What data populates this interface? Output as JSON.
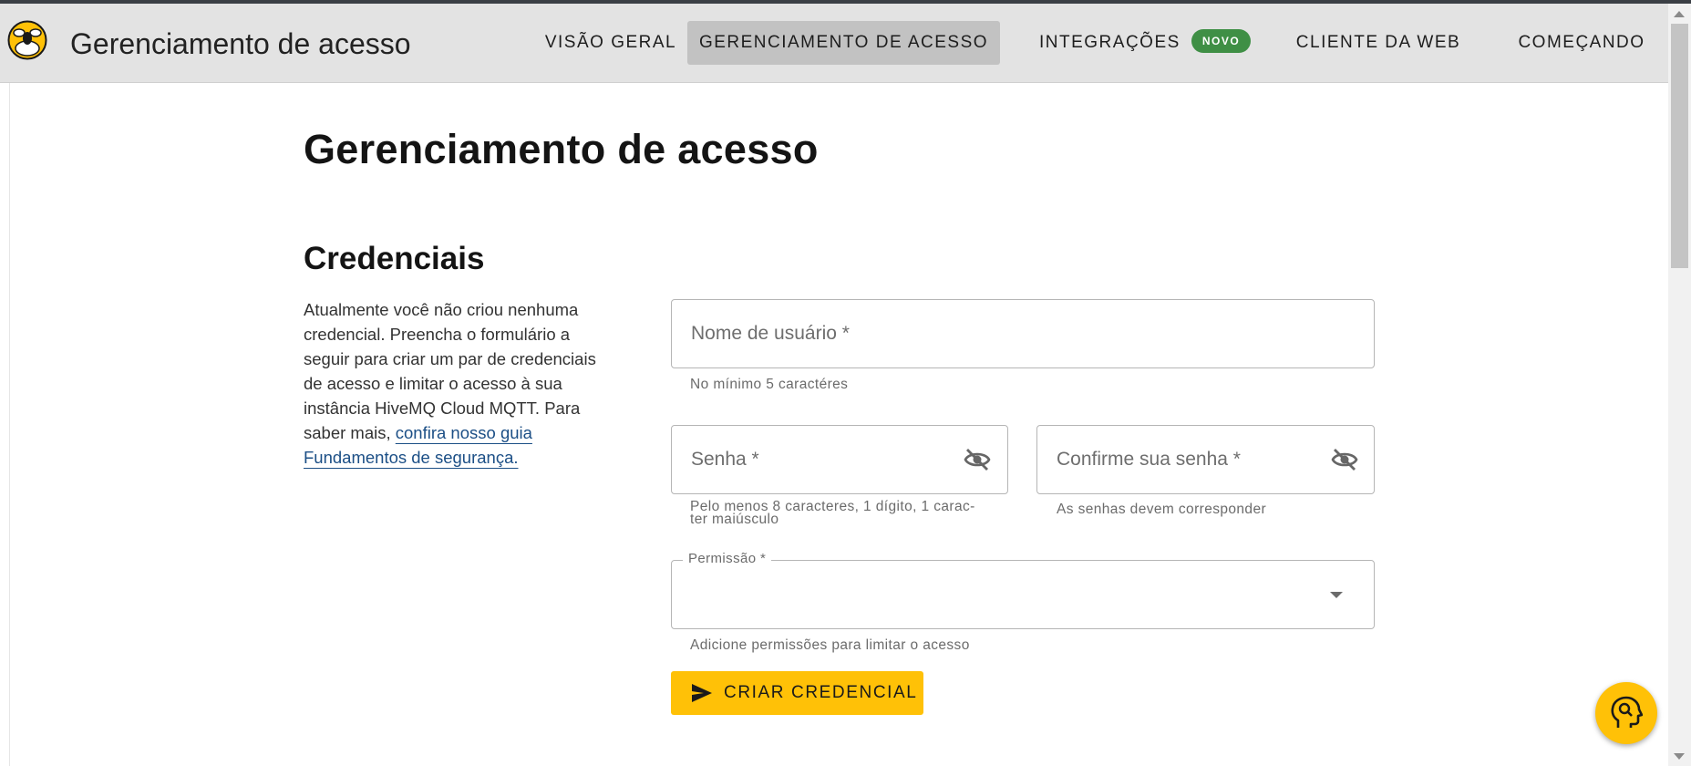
{
  "header": {
    "app_title": "Gerenciamento de acesso",
    "nav": [
      {
        "label": "VISÃO GERAL"
      },
      {
        "label": "GERENCIAMENTO DE ACESSO",
        "active": true
      },
      {
        "label": "INTEGRAÇÕES",
        "badge": "NOVO"
      },
      {
        "label": "CLIENTE DA WEB"
      },
      {
        "label": "COMEÇANDO"
      }
    ]
  },
  "main": {
    "page_title": "Gerenciamento de acesso",
    "section_title": "Credenciais",
    "intro_text": "Atualmente você não criou nenhuma credencial. Preencha o formulário a seguir para criar um par de credenciais de acesso e limitar o acesso à sua instância HiveMQ Cloud MQTT. Para saber mais, ",
    "intro_link": "confira nosso guia Fundamentos de segurança."
  },
  "form": {
    "username": {
      "placeholder": "Nome de usuário *",
      "helper": "No mínimo 5 caractéres"
    },
    "password": {
      "placeholder": "Senha *",
      "helper_line1": "Pelo menos 8 caracteres, 1 dígito, 1 carac-",
      "helper_line2": "ter maiúsculo"
    },
    "confirm": {
      "placeholder": "Confirme sua senha *",
      "helper": "As senhas devem corresponder"
    },
    "permission": {
      "label": "Permissão *",
      "value": "",
      "helper": "Adicione permissões para limitar o acesso"
    },
    "submit_label": "CRIAR CREDENCIAL"
  },
  "icons": {
    "logo": "hivemq-bee-logo",
    "password_visibility": "eye-off-icon",
    "dropdown": "caret-down-icon",
    "submit": "send-icon",
    "support": "support-chat-icon"
  },
  "colors": {
    "accent": "#ffc107",
    "badge": "#3f8f45",
    "link": "#1c4f86",
    "header_bg": "#e3e3e3",
    "nav_active_bg": "#c2c2c2"
  }
}
